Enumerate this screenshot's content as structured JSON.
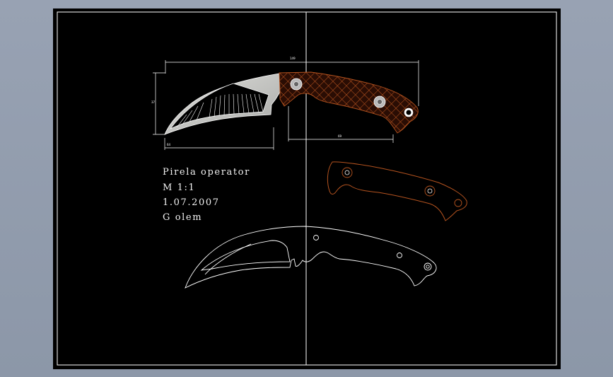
{
  "drawing": {
    "notes": {
      "line1": "Pirela operator",
      "line2": "M  1:1",
      "line3": "1.07.2007",
      "line4": "G olem"
    },
    "dimensions": {
      "overall_length": "149",
      "handle_length": "69",
      "blade_height": "37",
      "blade_reach": "64"
    }
  },
  "colors": {
    "workspace": "#8f9aab",
    "sheet": "#000000",
    "frame": "#ffffff",
    "handle_texture": "#b5531f",
    "blade": "#c8c8c8",
    "outline": "#ffffff"
  }
}
